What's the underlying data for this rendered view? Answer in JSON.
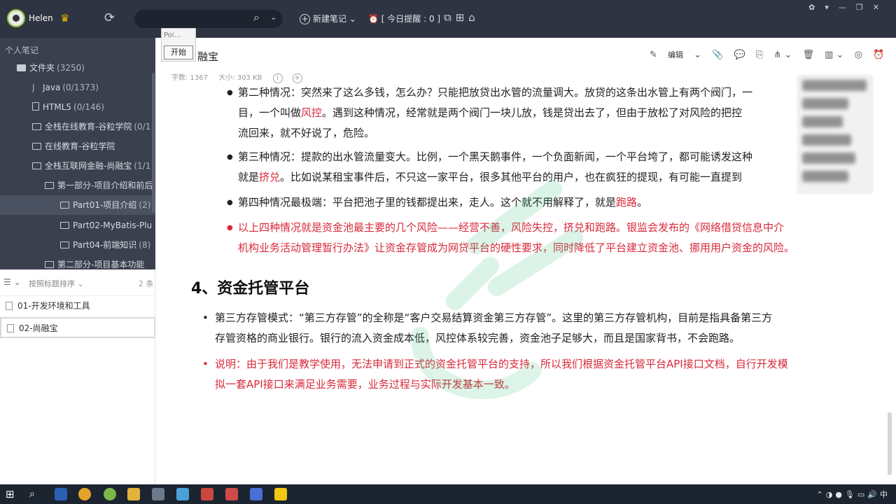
{
  "topbar": {
    "username": "Helen",
    "new_note": "新建笔记",
    "reminder": "[ 今日提醒 : 0 ]"
  },
  "sidebar": {
    "section_title": "个人笔记",
    "items": [
      {
        "label": "文件夹",
        "count": "(3250)"
      },
      {
        "label": "Java",
        "count": "(0/1373)"
      },
      {
        "label": "HTML5",
        "count": "(0/146)"
      },
      {
        "label": "全栈在线教育-谷粒学院",
        "count": "(0/1"
      },
      {
        "label": "在线教育-谷粒学院",
        "count": ""
      },
      {
        "label": "全栈互联网金融-尚融宝",
        "count": "(1/1"
      },
      {
        "label": "第一部分-项目介绍和前后",
        "count": ""
      },
      {
        "label": "Part01-项目介绍",
        "count": "(2)"
      },
      {
        "label": "Part02-MyBatis-Plu",
        "count": ""
      },
      {
        "label": "Part04-前端知识",
        "count": "(8)"
      },
      {
        "label": "第二部分-项目基本功能",
        "count": ""
      }
    ]
  },
  "popup": {
    "title": "Poi...",
    "button": "开始"
  },
  "notelist": {
    "sort_label": "按照标题排序",
    "count": "2 条",
    "notes": [
      "01-开发环境和工具",
      "02-尚融宝"
    ]
  },
  "editor": {
    "title": "融宝",
    "word_count": "字数: 1367",
    "size": "大小: 303 KB",
    "edit_label": "编辑",
    "p1": {
      "a": "第二种情况：突然来了这么多钱，怎么办？只能把放贷出水管的流量调大。放贷的这条出水管上有两个阀门，一",
      "b1": "目，一个叫做",
      "b_red": "风控",
      "b2": "。遇到这种情况，经常就是两个阀门一块儿放，钱是贷出去了，但由于放松了对风险的把控",
      "c": "流回来，就不好说了，危险。"
    },
    "p2": {
      "a": "第三种情况：提款的出水管流量变大。比例，一个黑天鹅事件，一个负面新闻，一个平台垮了，都可能诱发这种",
      "b1": "就是",
      "b_red": "挤兑",
      "b2": "。比如说某租宝事件后，不只这一家平台，很多其他平台的用户，也在疯狂的提现，有可能一直提到"
    },
    "p3": {
      "a": "第四种情况最极端：平台把池子里的钱都提出来，走人。这个就不用解释了，就是",
      "a_red": "跑路",
      "a2": "。"
    },
    "p4": {
      "a": "以上四种情况就是资金池最主要的几个风险——经营不善，风险失控，挤兑和跑路。银监会发布的《网络借贷信息中介",
      "b": "机构业务活动管理暂行办法》让资金存管成为网贷平台的硬性要求，同时降低了平台建立资金池、挪用用户资金的风险。"
    },
    "section_heading": "4、资金托管平台",
    "p5": {
      "a": "第三方存管模式：“第三方存管”的全称是“客户交易结算资金第三方存管”。这里的第三方存管机构，目前是指具备第三方",
      "b": "存管资格的商业银行。银行的流入资金成本低，风控体系较完善，资金池子足够大，而且是国家背书，不会跑路。"
    },
    "p6": {
      "a": "说明：由于我们是教学使用，无法申请到正式的资金托管平台的支持，所以我们根据资金托管平台API接口文档，自行开发模",
      "b": "拟一套API接口来满足业务需要，业务过程与实际开发基本一致。"
    }
  },
  "taskbar": {
    "lang": "中"
  },
  "colors": {
    "topbar": "#2f3442",
    "sidebar": "#3a404d",
    "red_text": "#d72a3a",
    "taskbar": "#1c2430"
  }
}
